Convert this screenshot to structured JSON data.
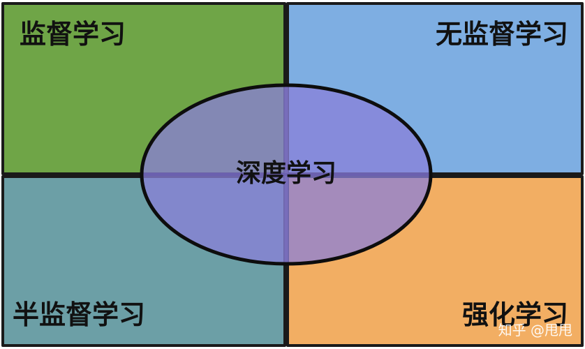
{
  "diagram": {
    "quadrants": {
      "top_left": {
        "label": "监督学习",
        "color": "#6fa547"
      },
      "top_right": {
        "label": "无监督学习",
        "color": "#7eaee2"
      },
      "bottom_left": {
        "label": "半监督学习",
        "color": "#6c9fa6"
      },
      "bottom_right": {
        "label": "强化学习",
        "color": "#f2ae63"
      }
    },
    "center": {
      "label": "深度学习",
      "color": "#8a7fd8"
    },
    "watermark": "知乎 @甩甩"
  }
}
